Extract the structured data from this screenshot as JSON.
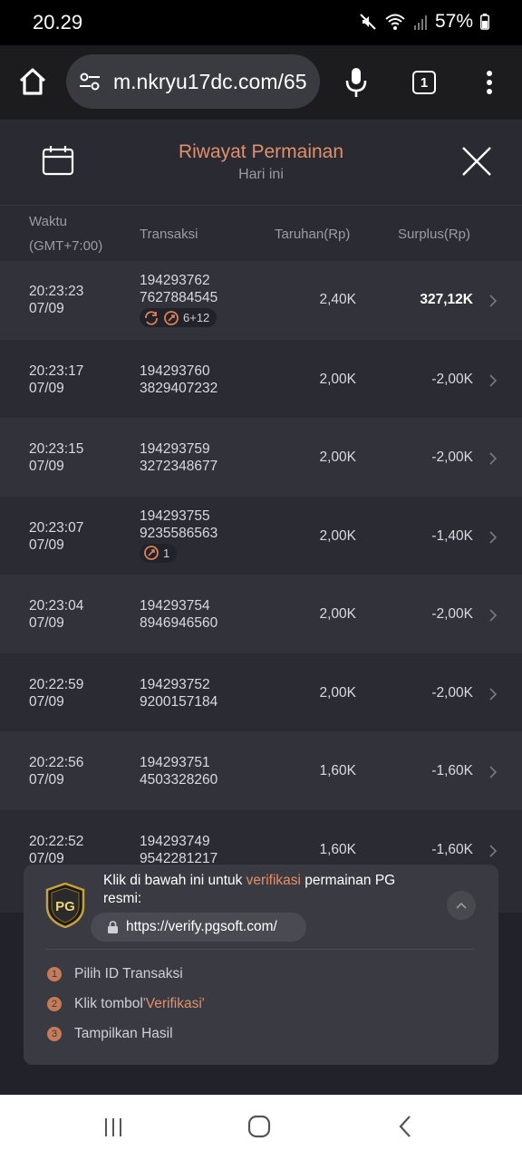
{
  "status_bar": {
    "time": "20.29",
    "battery": "57%"
  },
  "browser": {
    "url": "m.nkryu17dc.com/65",
    "tab_count": "1"
  },
  "header": {
    "title": "Riwayat Permainan",
    "subtitle": "Hari ini"
  },
  "columns": {
    "time": "Waktu",
    "timezone": "(GMT+7:00)",
    "transaction": "Transaksi",
    "bet": "Taruhan(Rp)",
    "surplus": "Surplus(Rp)"
  },
  "rows": [
    {
      "time": "20:23:23",
      "date": "07/09",
      "tx1": "194293762",
      "tx2": "7627884545",
      "bet": "2,40K",
      "surplus": "327,12K",
      "badge": "6+12"
    },
    {
      "time": "20:23:17",
      "date": "07/09",
      "tx1": "194293760",
      "tx2": "3829407232",
      "bet": "2,00K",
      "surplus": "-2,00K"
    },
    {
      "time": "20:23:15",
      "date": "07/09",
      "tx1": "194293759",
      "tx2": "3272348677",
      "bet": "2,00K",
      "surplus": "-2,00K"
    },
    {
      "time": "20:23:07",
      "date": "07/09",
      "tx1": "194293755",
      "tx2": "9235586563",
      "bet": "2,00K",
      "surplus": "-1,40K",
      "badge": "1"
    },
    {
      "time": "20:23:04",
      "date": "07/09",
      "tx1": "194293754",
      "tx2": "8946946560",
      "bet": "2,00K",
      "surplus": "-2,00K"
    },
    {
      "time": "20:22:59",
      "date": "07/09",
      "tx1": "194293752",
      "tx2": "9200157184",
      "bet": "2,00K",
      "surplus": "-2,00K"
    },
    {
      "time": "20:22:56",
      "date": "07/09",
      "tx1": "194293751",
      "tx2": "4503328260",
      "bet": "1,60K",
      "surplus": "-1,60K"
    },
    {
      "time": "20:22:52",
      "date": "07/09",
      "tx1": "194293749",
      "tx2": "9542281217",
      "bet": "1,60K",
      "surplus": "-1,60K"
    }
  ],
  "verify": {
    "text_before": "Klik di bawah ini untuk ",
    "text_accent": "verifikasi",
    "text_after": " permainan PG resmi:",
    "logo_text": "PG",
    "url": "https://verify.pgsoft.com/",
    "steps": [
      {
        "num": "1",
        "label": "Pilih ID Transaksi"
      },
      {
        "num": "2",
        "label_before": "Klik tombol ",
        "label_accent": "'Verifikasi'"
      },
      {
        "num": "3",
        "label": "Tampilkan Hasil"
      }
    ]
  }
}
